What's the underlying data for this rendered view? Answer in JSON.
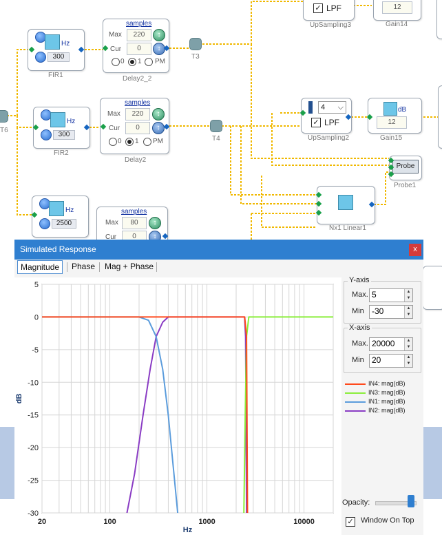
{
  "schematic": {
    "fir1": {
      "label": "FIR1",
      "unit": "Hz",
      "value": "300"
    },
    "fir2": {
      "label": "FIR2",
      "unit": "Hz",
      "value": "300"
    },
    "fir3": {
      "unit": "Hz",
      "value": "2500"
    },
    "delay2_2": {
      "label": "Delay2_2",
      "link": "samples",
      "max_label": "Max",
      "max_value": "220",
      "cur_label": "Cur",
      "cur_value": "0",
      "r0": "0",
      "r1": "1",
      "r2": "PM"
    },
    "delay2": {
      "label": "Delay2",
      "link": "samples",
      "max_label": "Max",
      "max_value": "220",
      "cur_label": "Cur",
      "cur_value": "0",
      "r0": "0",
      "r1": "1",
      "r2": "PM"
    },
    "delay3": {
      "link": "samples",
      "max_label": "Max",
      "max_value": "80",
      "cur_label": "Cur",
      "cur_value": "0"
    },
    "t3": "T3",
    "t4": "T4",
    "t6": "T6",
    "upsampling3": {
      "label": "UpSampling3",
      "lpf": "LPF"
    },
    "upsampling2": {
      "label": "UpSampling2",
      "lpf": "LPF",
      "factor": "4"
    },
    "gain14": {
      "label": "Gain14",
      "value": "12"
    },
    "gain15": {
      "label": "Gain15",
      "unit": "dB",
      "value": "12"
    },
    "probe1": {
      "label": "Probe1",
      "button": "Probe"
    },
    "nx1": {
      "label": "Nx1 Linear1"
    }
  },
  "dialog": {
    "title": "Simulated Response",
    "close": "x",
    "tabs": [
      "Magnitude",
      "Phase",
      "Mag + Phase"
    ],
    "yaxis": {
      "title": "Y-axis",
      "max_label": "Max.",
      "max": "5",
      "min_label": "Min",
      "min": "-30"
    },
    "xaxis": {
      "title": "X-axis",
      "max_label": "Max.",
      "max": "20000",
      "min_label": "Min",
      "min": "20"
    },
    "opacity_label": "Opacity:",
    "opacity": 0.95,
    "window_on_top": "Window On Top"
  },
  "colors": {
    "in4": "#ff4a1c",
    "in3": "#8aee3a",
    "in1": "#5b9cdc",
    "in2": "#8a3cc4",
    "wire": "#f0b800",
    "title": "#2f7fd0"
  },
  "chart_data": {
    "type": "line",
    "xlabel": "Hz",
    "ylabel": "dB",
    "xscale": "log",
    "xlim": [
      20,
      20000
    ],
    "ylim": [
      -30,
      5
    ],
    "xticks": [
      "20",
      "100",
      "1000",
      "10000"
    ],
    "yticks": [
      "5",
      "0",
      "-5",
      "-10",
      "-15",
      "-20",
      "-25",
      "-30"
    ],
    "grid": true,
    "legend": "right",
    "series": [
      {
        "name": "IN4: mag(dB)",
        "color": "#ff4a1c",
        "x": [
          20,
          100,
          300,
          1000,
          2000,
          2450,
          2560,
          2620
        ],
        "y": [
          0,
          0,
          0,
          0,
          0,
          0,
          -3,
          -30
        ]
      },
      {
        "name": "IN3: mag(dB)",
        "color": "#8aee3a",
        "x": [
          2400,
          2480,
          2560,
          2700,
          3000,
          10000,
          20000
        ],
        "y": [
          -30,
          -15,
          -3,
          0,
          0,
          0,
          0
        ]
      },
      {
        "name": "IN1: mag(dB)",
        "color": "#5b9cdc",
        "x": [
          20,
          100,
          200,
          250,
          300,
          350,
          400,
          450,
          500
        ],
        "y": [
          0,
          0,
          0,
          -0.5,
          -3,
          -8,
          -15,
          -23,
          -30
        ]
      },
      {
        "name": "IN2: mag(dB)",
        "color": "#8a3cc4",
        "x": [
          150,
          180,
          220,
          260,
          300,
          350,
          400,
          500,
          1000,
          2000,
          2440,
          2500,
          2560
        ],
        "y": [
          -30,
          -24,
          -15,
          -8,
          -3,
          -0.8,
          0,
          0,
          0,
          0,
          0,
          -3,
          -30
        ]
      }
    ]
  }
}
